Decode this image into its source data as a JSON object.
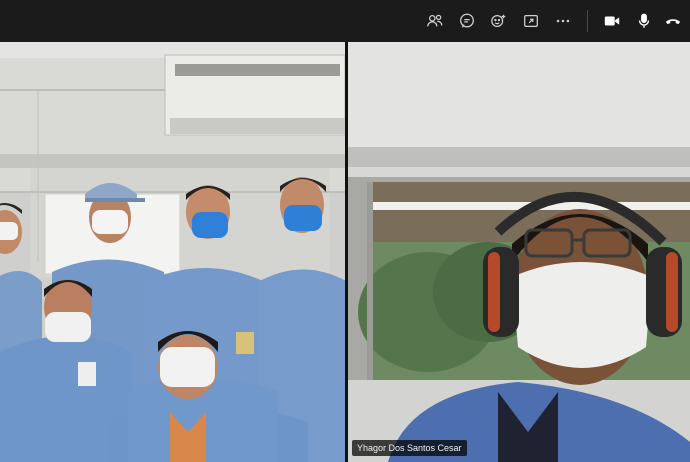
{
  "toolbar": {
    "icons": [
      "people-icon",
      "chat-icon",
      "reactions-icon",
      "share-screen-icon",
      "more-icon",
      "camera-icon",
      "microphone-icon",
      "hangup-icon"
    ]
  },
  "participants": [
    {
      "id": "room-group",
      "name": ""
    },
    {
      "id": "remote-user",
      "name": "Yhagor Dos Santos Cesar"
    }
  ],
  "colors": {
    "toolbar_bg": "#1b1b1b",
    "uniform_blue": "#6f93c4",
    "mask_blue": "#2e7fd6",
    "mask_white": "#f0f0f0"
  }
}
